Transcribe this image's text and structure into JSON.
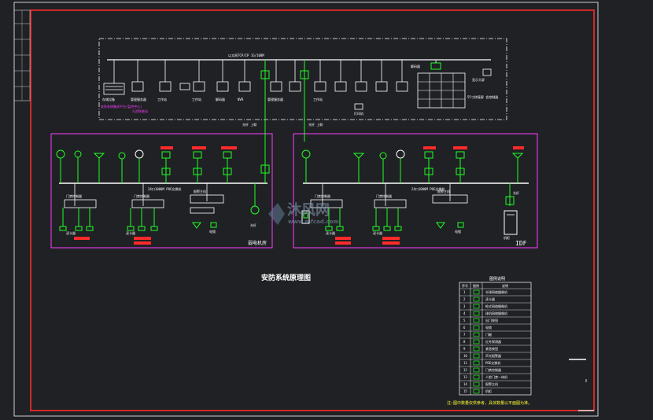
{
  "network": {
    "backbone_label": "以太网TCP/IP 1G/100M",
    "core_label": "核心交换机",
    "storage_label": "存储设备",
    "decoder_label": "解码器",
    "wall_label": "显示大屏",
    "server_label": "管理服务器",
    "workstation_label": "工作站",
    "printer_label": "打印机",
    "nvr_label": "NVR",
    "note_magenta_1": "安防系统集成平台(监控中心)",
    "note_magenta_2": "与消防联动",
    "videowall_note": "55寸拼接屏 含控制器",
    "uplink_left": "光纤 上联",
    "uplink_right": "光纤 上联"
  },
  "rooms": {
    "left": {
      "name": "弱电机房",
      "switch_label": "24口1000M POE交换机",
      "cable_label": "六类网线",
      "fiber_label": "光纤",
      "sub_labels": [
        "门禁控制器",
        "门禁控制器",
        "报警主机"
      ],
      "device_labels": [
        "读卡器",
        "出门按钮",
        "电锁",
        "读卡器",
        "出门按钮",
        "电锁"
      ]
    },
    "right": {
      "name": "IDF",
      "switch_label": "24口1000M POE交换机",
      "cable_label": "六类网线",
      "fiber_label": "光纤",
      "sub_labels": [
        "门禁控制器",
        "门禁控制器",
        "报警主机"
      ],
      "device_labels": [
        "读卡器",
        "出门按钮",
        "电锁",
        "读卡器",
        "出门按钮",
        "电锁"
      ],
      "cabinet_label": "机柜"
    }
  },
  "diagram_title": "安防系统原理图",
  "legend": {
    "title": "图例说明",
    "header_no": "序号",
    "header_sym": "图例",
    "header_desc": "说明",
    "rows": [
      {
        "no": "1",
        "desc": "半球网络摄像机"
      },
      {
        "no": "2",
        "desc": "读卡器"
      },
      {
        "no": "3",
        "desc": "枪式网络摄像机"
      },
      {
        "no": "4",
        "desc": "球机网络摄像机"
      },
      {
        "no": "5",
        "desc": "出门按钮"
      },
      {
        "no": "6",
        "desc": "电锁"
      },
      {
        "no": "7",
        "desc": "门磁"
      },
      {
        "no": "8",
        "desc": "红外探测器"
      },
      {
        "no": "9",
        "desc": "紧急按钮"
      },
      {
        "no": "10",
        "desc": "声光报警器"
      },
      {
        "no": "11",
        "desc": "POE交换机"
      },
      {
        "no": "12",
        "desc": "门禁控制器"
      },
      {
        "no": "13",
        "desc": "人脸门禁一体机"
      },
      {
        "no": "14",
        "desc": "报警主机"
      },
      {
        "no": "15",
        "desc": "机柜"
      }
    ],
    "note": "注:图中数量仅供参考，具体数量以平面图为准。"
  },
  "watermark": {
    "cn": "沐风网",
    "en": "www.mfcad.com"
  },
  "colors": {
    "frame_red": "#ff2a2a",
    "symbol_green": "#22ff22",
    "label_magenta": "#ff3dff",
    "background": "#1f2125"
  }
}
